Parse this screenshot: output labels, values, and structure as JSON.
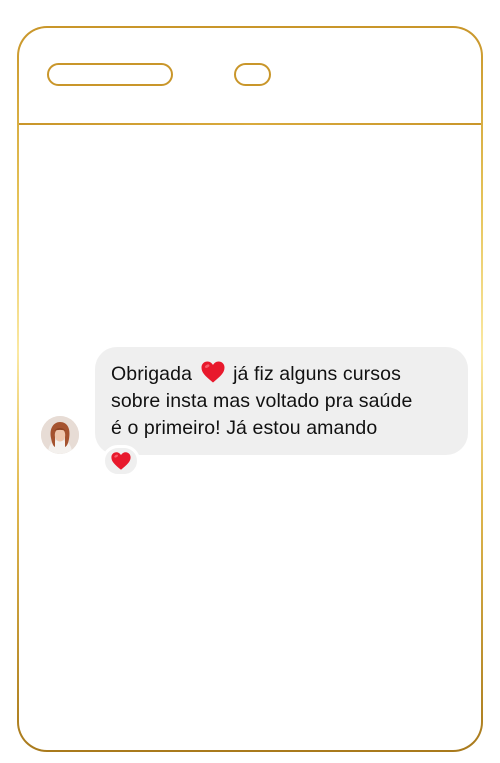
{
  "colors": {
    "frame_gold": "#c9962a",
    "bubble_bg": "#efefef",
    "text": "#111111",
    "heart": "#e8192c"
  },
  "phone": {
    "speaker_icon": "speaker-slot",
    "camera_icon": "front-camera"
  },
  "message": {
    "sender_avatar": "avatar",
    "line1_before": "Obrigada",
    "heart_emoji": "heart-icon",
    "line1_after": "já fiz alguns cursos",
    "line2": "sobre insta mas voltado pra saúde",
    "line3": "é o primeiro! Já estou amando",
    "reaction_icon": "heart-reaction-icon"
  }
}
